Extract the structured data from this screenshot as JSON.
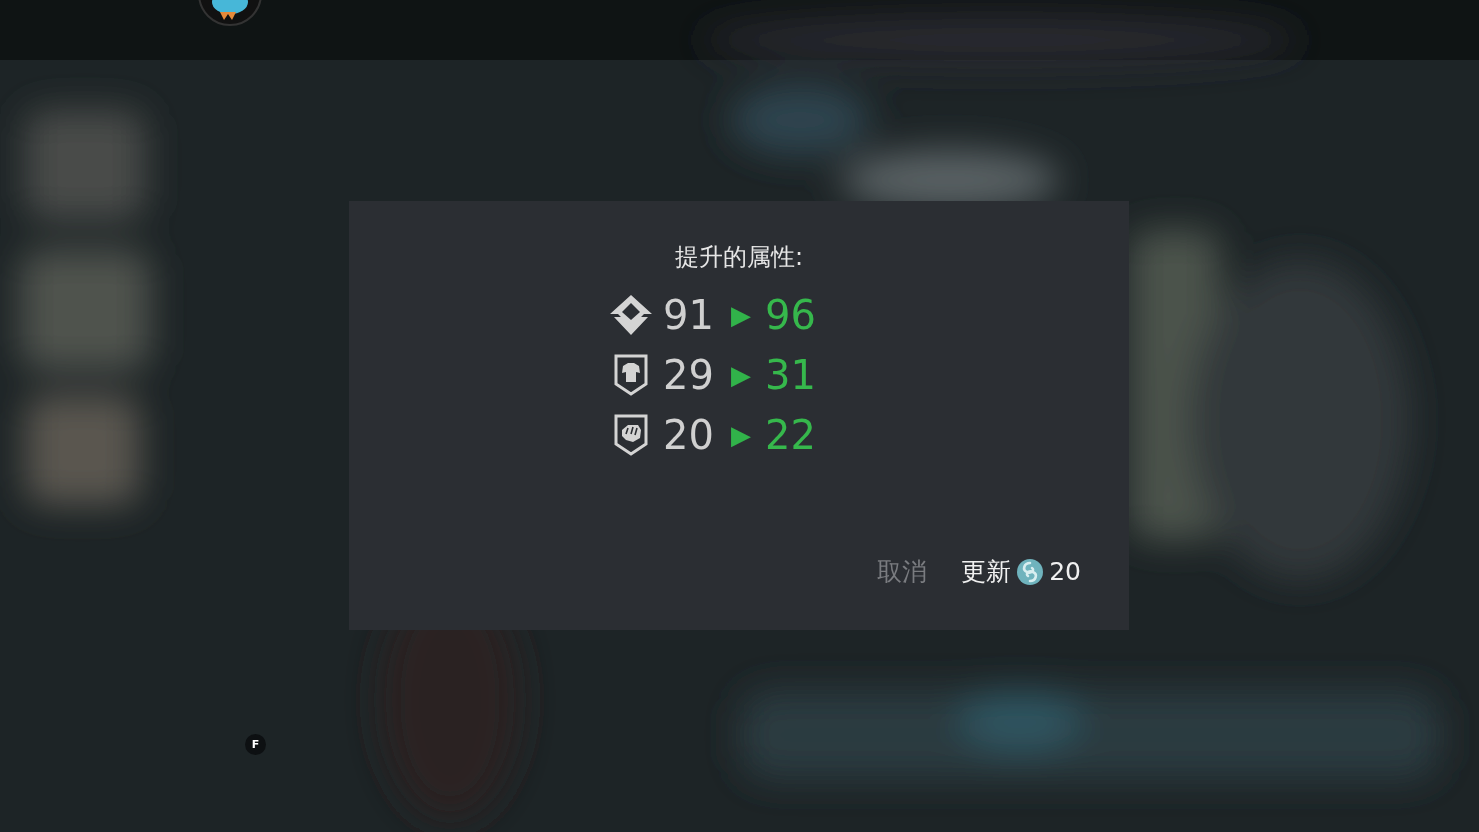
{
  "dialog": {
    "title": "提升的属性:",
    "stats": [
      {
        "kind": "power",
        "from": "91",
        "arrow": "▶",
        "to": "96"
      },
      {
        "kind": "armor",
        "from": "29",
        "arrow": "▶",
        "to": "31"
      },
      {
        "kind": "strength",
        "from": "20",
        "arrow": "▶",
        "to": "22"
      }
    ],
    "buttons": [
      {
        "label": "取消",
        "kind": "cancel"
      },
      {
        "label": "更新",
        "kind": "confirm",
        "cost": "20"
      }
    ]
  },
  "key_hint": "F"
}
